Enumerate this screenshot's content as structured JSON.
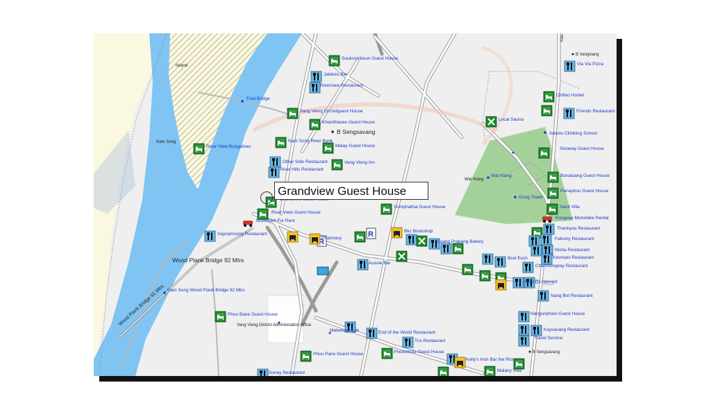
{
  "map": {
    "callout_title": "Grandview Guest House",
    "colors": {
      "river": "#7fc4f2",
      "land": "#efefef",
      "sand": "#fbf8e0",
      "park": "#a4d19a",
      "road": "#a8a8a8",
      "label": "#1a36c8"
    },
    "area_labels": [
      {
        "id": "island",
        "text": "Island"
      },
      {
        "id": "nam-song",
        "text": "Nam Song"
      },
      {
        "id": "b-sengsavang",
        "text": "B  Sengsavang"
      },
      {
        "id": "wat-klang-area",
        "text": "Wat Klang"
      },
      {
        "id": "b-vangviang",
        "text": "B Vangviang"
      },
      {
        "id": "b-sengsavang-2",
        "text": "B Sengsavang"
      },
      {
        "id": "vang-vieng-admin",
        "text": "Vang Vieng District Administration Office"
      },
      {
        "id": "kau-road",
        "text": "Kau"
      }
    ],
    "road_labels": [
      {
        "id": "wood-bridge-1",
        "text": "Wood Plank Bridge 92 Mtrs"
      },
      {
        "id": "wood-bridge-2",
        "text": "Wood Plank Bridge 92 Mtrs"
      },
      {
        "id": "nam-song-bridge",
        "text": "Nam Song Wood Plank Bridge 92 Mtrs"
      },
      {
        "id": "foot-bridge",
        "text": "Foot Bridge"
      }
    ],
    "pois": [
      {
        "id": "souksomboun",
        "text": "Souksomboun Guest House",
        "kind": "lodging"
      },
      {
        "id": "jaidees-bar",
        "text": "Jaidees Bar",
        "kind": "food"
      },
      {
        "id": "riverview-restaurant",
        "text": "Riverview Restaurant",
        "kind": "food"
      },
      {
        "id": "vang-vieng-orchid",
        "text": "Vang Vieng Orchidguest House",
        "kind": "lodging"
      },
      {
        "id": "khamlhavee",
        "text": "Khamlhavee Guest House",
        "kind": "lodging"
      },
      {
        "id": "nam-song-river-bank",
        "text": "Nam Song River Bank",
        "kind": "lodging"
      },
      {
        "id": "malay-guest-house",
        "text": "Malay Guest House",
        "kind": "lodging"
      },
      {
        "id": "other-side-restaurant",
        "text": "Other Side Restaurant",
        "kind": "food"
      },
      {
        "id": "river-hills-restaurant",
        "text": "River Hills Restaurant",
        "kind": "food"
      },
      {
        "id": "vang-vieng-inn",
        "text": "Vang Vieng Inn",
        "kind": "lodging"
      },
      {
        "id": "river-view-bungalows",
        "text": "River View Bungalows",
        "kind": "lodging"
      },
      {
        "id": "grandview-small",
        "text": "Grandview Guest House",
        "kind": "lodging"
      },
      {
        "id": "river-view-guest-house",
        "text": "River View Guest House",
        "kind": "lodging"
      },
      {
        "id": "motorbike-for-rent",
        "text": "Motorbike For Rent",
        "kind": "rental"
      },
      {
        "id": "saynamsong-restaurant",
        "text": "Saynamsong Restaurant",
        "kind": "food"
      },
      {
        "id": "pharmacy",
        "text": "Pharmacy",
        "kind": "pharmacy"
      },
      {
        "id": "somphathai",
        "text": "Somphathai Guest House",
        "kind": "lodging"
      },
      {
        "id": "bkc-bookshop",
        "text": "Bkc Bookshop",
        "kind": "shop"
      },
      {
        "id": "luang-prabang-bakery",
        "text": "Luang Prabang Bakery",
        "kind": "food"
      },
      {
        "id": "aussie-bar",
        "text": "Aussie Bar",
        "kind": "food"
      },
      {
        "id": "phou-bane",
        "text": "Phou Bane Guest House",
        "kind": "lodging"
      },
      {
        "id": "maleewan-lab",
        "text": "Maleewan Lab",
        "kind": "food"
      },
      {
        "id": "end-of-world",
        "text": "End of the World Restaurant",
        "kind": "food"
      },
      {
        "id": "tns-restaurant",
        "text": "Tns Restaurant",
        "kind": "food"
      },
      {
        "id": "phonethida",
        "text": "Phonethida Guest House",
        "kind": "lodging"
      },
      {
        "id": "phou-pane",
        "text": "Phou Pane Guest House",
        "kind": "lodging"
      },
      {
        "id": "irish-bar",
        "text": "Kelly's Irish Bar the Rising",
        "kind": "food"
      },
      {
        "id": "malany-villa",
        "text": "Malany Villa",
        "kind": "lodging"
      },
      {
        "id": "soney-restaurant",
        "text": "Soney Restaurant",
        "kind": "food"
      },
      {
        "id": "via-via-pizza",
        "text": "Via Via Pizza",
        "kind": "food"
      },
      {
        "id": "chillao-hostel",
        "text": "Chillao Hostel",
        "kind": "lodging"
      },
      {
        "id": "friends-restaurant",
        "text": "Friends Restaurant",
        "kind": "food"
      },
      {
        "id": "local-sauna",
        "text": "Local Sauna",
        "kind": "service"
      },
      {
        "id": "adams-climbing",
        "text": "Adams Climbing School",
        "kind": "service"
      },
      {
        "id": "siviaxay",
        "text": "Siviaxay Guest House",
        "kind": "lodging"
      },
      {
        "id": "wat-klang",
        "text": "Wat Klang",
        "kind": "temple"
      },
      {
        "id": "bonaluang",
        "text": "Bonaluang Guest House",
        "kind": "lodging"
      },
      {
        "id": "panephou",
        "text": "Panephou Guest House",
        "kind": "lodging"
      },
      {
        "id": "gong-tower",
        "text": "Gong Tower",
        "kind": "landmark"
      },
      {
        "id": "santi-villa",
        "text": "Santi Villa",
        "kind": "lodging"
      },
      {
        "id": "kongsee",
        "text": "Kongsee Motorbike Rental",
        "kind": "rental"
      },
      {
        "id": "thankyou-restaurant",
        "text": "Thankyou Restaurant",
        "kind": "food"
      },
      {
        "id": "falcony",
        "text": "Falcony Restaurant",
        "kind": "food"
      },
      {
        "id": "nisha",
        "text": "Nisha Restaurant",
        "kind": "food"
      },
      {
        "id": "keomani",
        "text": "Keomani Restaurant",
        "kind": "food"
      },
      {
        "id": "chanthongxay",
        "text": "Chanthongxay Restaurant",
        "kind": "food"
      },
      {
        "id": "pool-restaurant",
        "text": "Pool Restaurant",
        "kind": "food"
      },
      {
        "id": "nang-bot",
        "text": "Nang Bot Restaurant",
        "kind": "food"
      },
      {
        "id": "bcel",
        "text": "Bcel Exch",
        "kind": "bank"
      },
      {
        "id": "nangunphani",
        "text": "Nangunphani Guest House",
        "kind": "lodging"
      },
      {
        "id": "kaysavang",
        "text": "Kaysavang Restaurant",
        "kind": "food"
      },
      {
        "id": "travel-service",
        "text": "Travel Service",
        "kind": "service"
      }
    ]
  }
}
